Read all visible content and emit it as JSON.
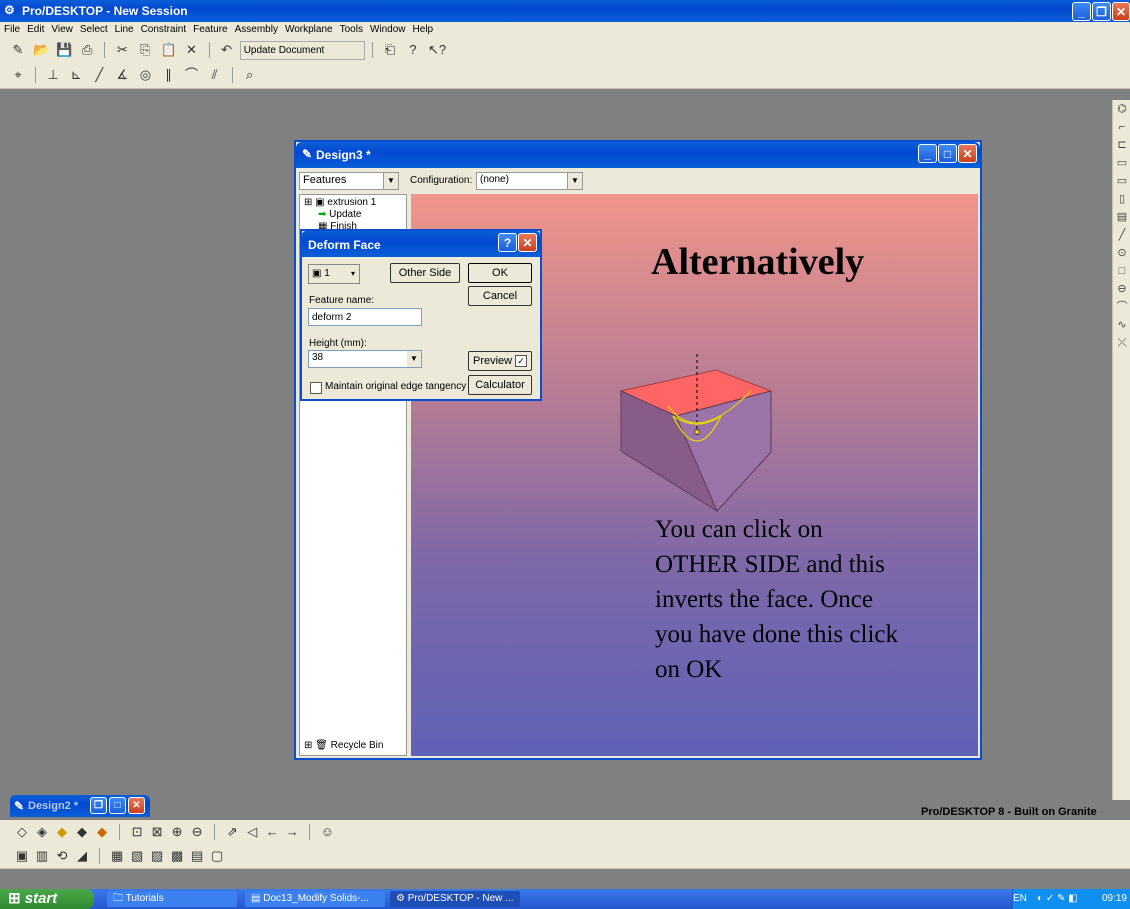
{
  "app": {
    "title": "Pro/DESKTOP - New Session"
  },
  "menu": [
    "File",
    "Edit",
    "View",
    "Select",
    "Line",
    "Constraint",
    "Feature",
    "Assembly",
    "Workplane",
    "Tools",
    "Window",
    "Help"
  ],
  "toolbar": {
    "update_label": "Update Document"
  },
  "design3": {
    "title": "Design3 *",
    "browser_select": "Features",
    "config_label": "Configuration:",
    "config_value": "(none)",
    "tree": [
      "extrusion 1",
      "Update",
      "Finish"
    ],
    "recycle": "Recycle Bin",
    "slide_heading": "Alternatively",
    "slide_text": "You can click on OTHER SIDE and this inverts the face. Once you have done this click on OK"
  },
  "dialog": {
    "title": "Deform Face",
    "face_value": "1",
    "other_side": "Other Side",
    "ok": "OK",
    "cancel": "Cancel",
    "feature_name_label": "Feature name:",
    "feature_name_value": "deform 2",
    "height_label": "Height (mm):",
    "height_value": "38",
    "preview": "Preview",
    "calculator": "Calculator",
    "tangency": "Maintain original edge tangency"
  },
  "design2": {
    "title": "Design2 *"
  },
  "brand": "Pro/DESKTOP 8 - Built on Granite",
  "taskbar": {
    "start": "start",
    "items": [
      "Tutorials",
      "Doc13_Modify Solids-...",
      "Pro/DESKTOP - New ..."
    ],
    "lang": "EN",
    "time": "09:19"
  }
}
